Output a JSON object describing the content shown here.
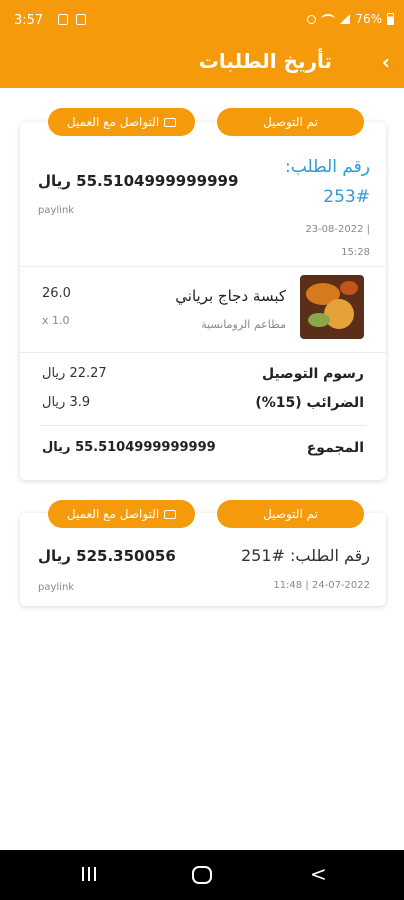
{
  "status_bar": {
    "time": "3:57",
    "battery": "76%"
  },
  "header": {
    "title": "تأريخ الطلبات",
    "back_icon": "‹"
  },
  "orders": [
    {
      "status_label": "تم التوصيل",
      "contact_label": "التواصل مع العميل",
      "order_label": "رقم الطلب:",
      "order_number": "253#",
      "amount": "55.5104999999999 ريال",
      "payment_method": "paylink",
      "date": "23-08-2022 |",
      "time": "15:28",
      "item": {
        "name": "كبسة دجاج برياني",
        "restaurant": "مطاعم الرومانسية",
        "price": "26.0",
        "quantity": "x 1.0"
      },
      "delivery_fee_label": "رسوم التوصيل",
      "delivery_fee": "22.27 ريال",
      "tax_label": "الضرائب (15%)",
      "tax": "3.9 ريال",
      "total_label": "المجموع",
      "total": "55.5104999999999 ريال"
    },
    {
      "status_label": "تم التوصيل",
      "contact_label": "التواصل مع العميل",
      "order_title": "رقم الطلب: #251",
      "amount": "525.350056 ريال",
      "payment_method": "paylink",
      "datetime": "11:48 | 24-07-2022"
    }
  ]
}
